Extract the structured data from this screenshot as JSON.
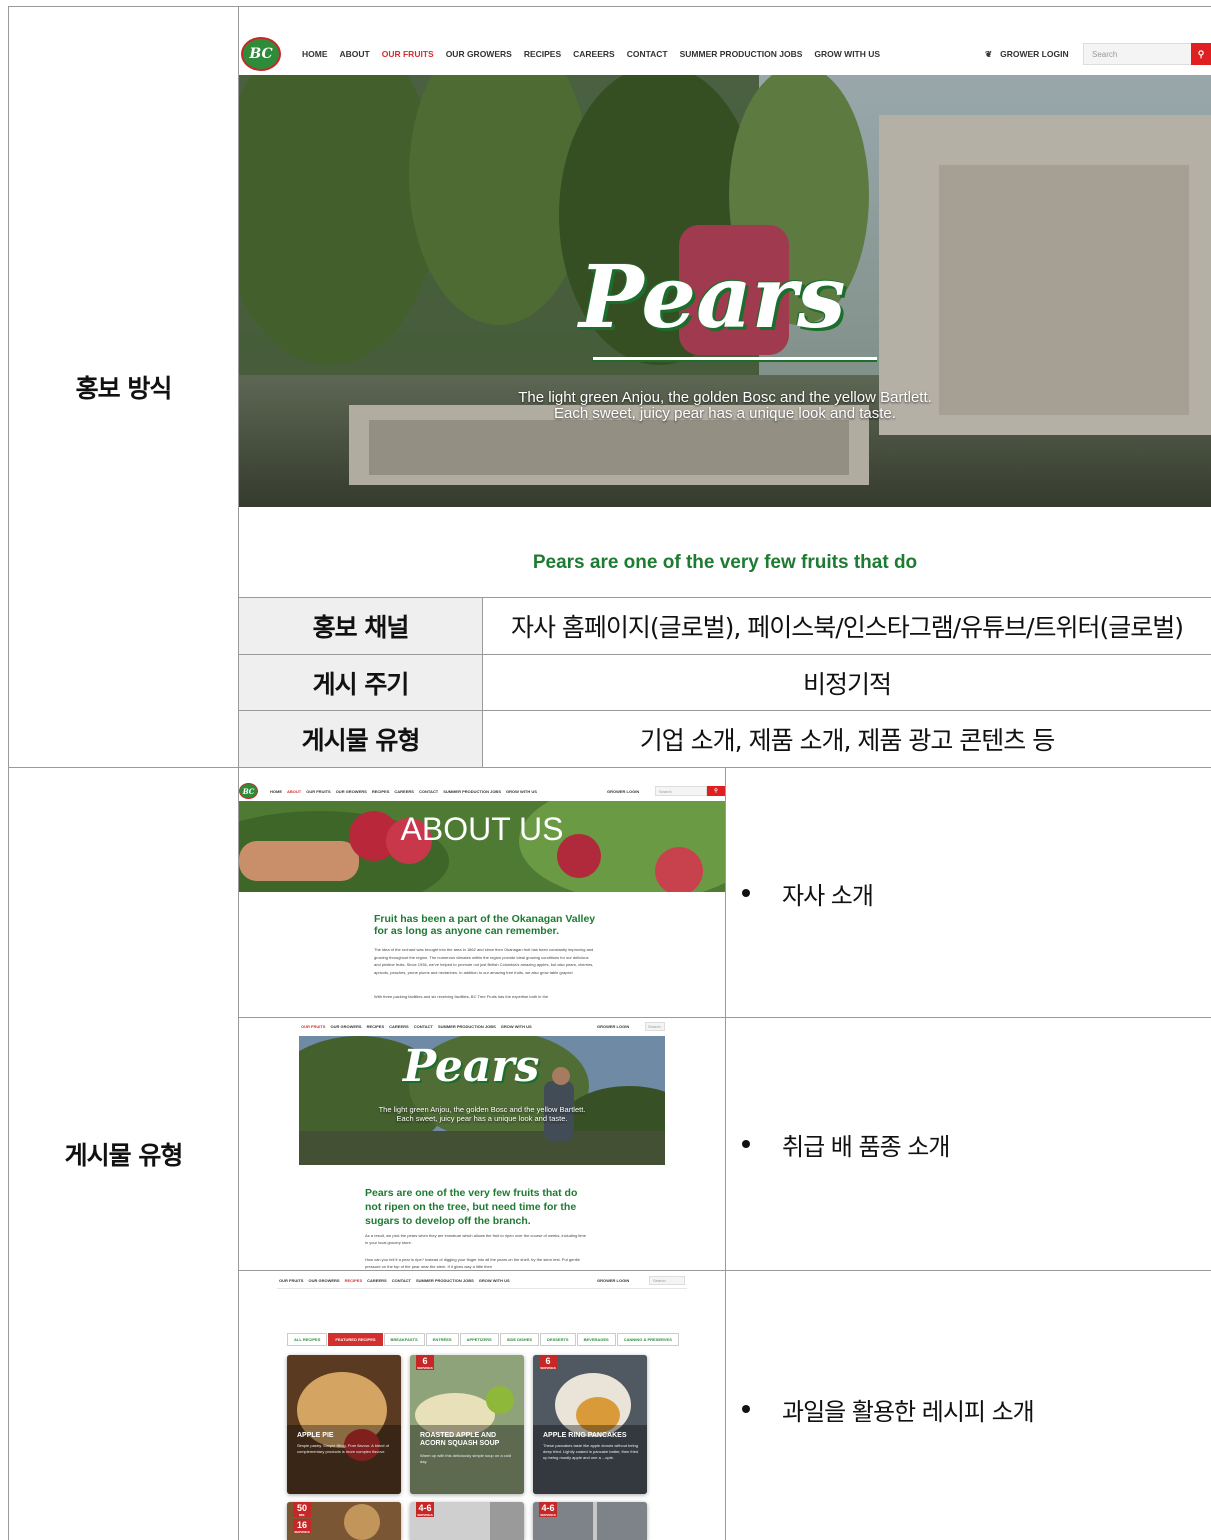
{
  "section_labels": {
    "promo": "홍보 방식",
    "post_types": "게시물 유형"
  },
  "hero_site": {
    "logo": "BC",
    "nav": [
      "HOME",
      "ABOUT",
      "OUR FRUITS",
      "OUR GROWERS",
      "RECIPES",
      "CAREERS",
      "CONTACT",
      "SUMMER PRODUCTION JOBS",
      "GROW WITH US"
    ],
    "active": "OUR FRUITS",
    "login": "GROWER LOGIN",
    "search_placeholder": "Search",
    "title": "Pears",
    "caption_1": "The light green Anjou, the golden Bosc and the yellow Bartlett.",
    "caption_2": "Each sweet, juicy pear has a unique look and taste.",
    "subheading": "Pears are one of the very few fruits that do"
  },
  "info_table": [
    {
      "key": "홍보 채널",
      "value": "자사 홈페이지(글로벌),  페이스북/인스타그램/유튜브/트위터(글로벌)"
    },
    {
      "key": "게시 주기",
      "value": "비정기적"
    },
    {
      "key": "게시물 유형",
      "value": "기업 소개,  제품 소개,  제품 광고 콘텐츠 등"
    }
  ],
  "about_shot": {
    "nav": [
      "HOME",
      "ABOUT",
      "OUR FRUITS",
      "OUR GROWERS",
      "RECIPES",
      "CAREERS",
      "CONTACT",
      "SUMMER PRODUCTION JOBS",
      "GROW WITH US"
    ],
    "active": "ABOUT",
    "login": "GROWER LOGIN",
    "search_placeholder": "Search",
    "title": "ABOUT US",
    "heading_1": "Fruit has been a part of the Okanagan Valley",
    "heading_2": "for as long as anyone can remember.",
    "para_1": "The idea of the orchard was brought into the area in 1862 and since then Okanagan fruit has been constantly improving and growing throughout the region. The numerous climates within the region provide ideal growing conditions for our delicious and pristine fruits. Since 1936, we've helped to promote not just British Columbia's amazing apples, but also pears, cherries, apricots, peaches, prune plums and nectarines. In addition to our amazing tree fruits, we also grow table grapes!",
    "para_2": "With three packing facilities and six receiving facilities, BC Tree Fruits has the expertise both in the"
  },
  "pears_shot": {
    "nav": [
      "OUR FRUITS",
      "OUR GROWERS",
      "RECIPES",
      "CAREERS",
      "CONTACT",
      "SUMMER PRODUCTION JOBS",
      "GROW WITH US"
    ],
    "active": "OUR FRUITS",
    "login": "GROWER LOGIN",
    "search_placeholder": "Search",
    "title": "Pears",
    "caption_1": "The light green Anjou, the golden Bosc and the yellow Bartlett.",
    "caption_2": "Each sweet, juicy pear has a unique look and taste.",
    "heading_1": "Pears are one of the very few fruits that do",
    "heading_2": "not ripen on the tree, but need time for the",
    "heading_3": "sugars to develop off the branch.",
    "para_1": "As a result, we pick the pears when they are immature which allows the fruit to ripen over the course of weeks, including time in your local grocery store.",
    "para_2": "How can you tell if a pear is ripe? Instead of digging your finger into all the pears on the shelf, try the stem test. Put gentle pressure on the top of the pear near the stem. If it gives way a little then"
  },
  "recipes_shot": {
    "nav": [
      "OUR FRUITS",
      "OUR GROWERS",
      "RECIPES",
      "CAREERS",
      "CONTACT",
      "SUMMER PRODUCTION JOBS",
      "GROW WITH US"
    ],
    "active": "RECIPES",
    "login": "GROWER LOGIN",
    "search_placeholder": "Search",
    "tabs": [
      "ALL RECIPES",
      "FEATURED RECIPES",
      "BREAKFASTS",
      "ENTRÉES",
      "APPETIZERS",
      "SIDE DISHES",
      "DESSERTS",
      "BEVERAGES",
      "CANNING & PRESERVES"
    ],
    "active_tab": "FEATURED RECIPES",
    "cards": [
      {
        "title": "APPLE PIE",
        "desc": "Simple pastry. Simple filling. Pure flavour. A blend of complementary products is more complex flavour."
      },
      {
        "badge": "6",
        "badge_unit": "SERVINGS",
        "title": "ROASTED APPLE AND ACORN SQUASH SOUP",
        "desc": "Warm up with this deliciously simple soup on a cold day."
      },
      {
        "badge": "6",
        "badge_unit": "SERVINGS",
        "title": "APPLE RING PANCAKES",
        "desc": "These pancakes taste like apple donuts without being deep fried. Lightly coated in pancake batter, then fried up being mostly apple and one a ...ople."
      },
      {
        "badge": "50",
        "badge_unit": "MIN.",
        "badge2": "16",
        "badge2_unit": "SERVINGS"
      },
      {
        "badge": "4-6",
        "badge_unit": "SERVINGS"
      },
      {
        "badge": "4-6",
        "badge_unit": "SERVINGS"
      }
    ]
  },
  "bullets": [
    "자사 소개",
    "취급 배 품종 소개",
    "과일을 활용한 레시피 소개"
  ],
  "colors": {
    "brand_red": "#e02020",
    "brand_green": "#1e7b32"
  }
}
